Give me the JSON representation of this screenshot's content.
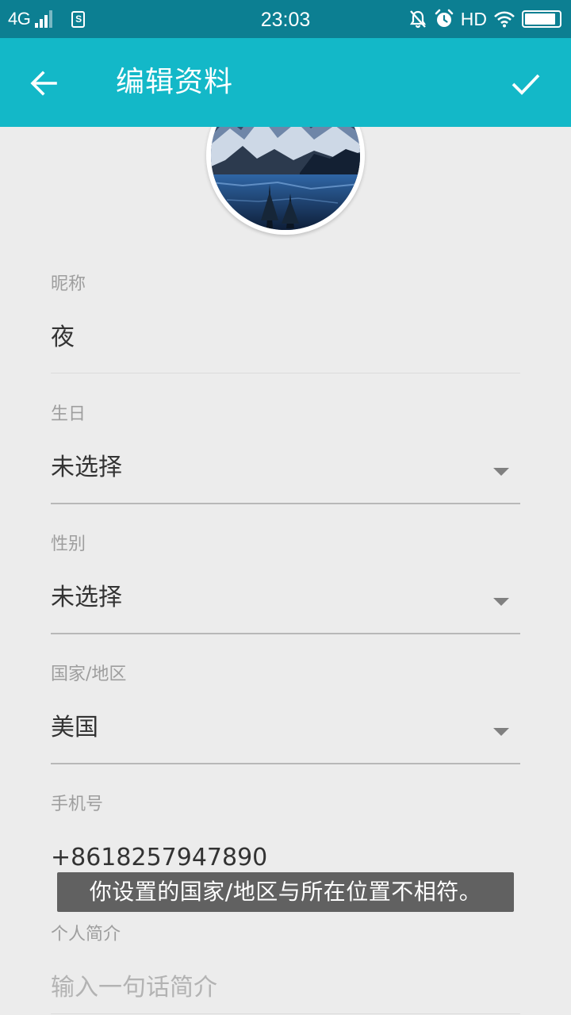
{
  "status_bar": {
    "network": "4G",
    "time": "23:03",
    "hd": "HD",
    "sd_icon_label": "S",
    "battery_level": 0.9,
    "icons": [
      "signal-icon",
      "sd-card-icon",
      "bell-off-icon",
      "alarm-icon",
      "wifi-icon",
      "battery-icon"
    ]
  },
  "app_bar": {
    "title": "编辑资料",
    "back_icon": "arrow-left-icon",
    "confirm_icon": "check-icon",
    "color": "#13b8c8"
  },
  "avatar": {
    "icon": "avatar-lake-mountain-image"
  },
  "form": {
    "nickname": {
      "label": "昵称",
      "value": "夜"
    },
    "birthday": {
      "label": "生日",
      "value": "未选择"
    },
    "gender": {
      "label": "性别",
      "value": "未选择"
    },
    "region": {
      "label": "国家/地区",
      "value": "美国"
    },
    "phone": {
      "label": "手机号",
      "value": "+8618257947890"
    },
    "bio": {
      "label": "个人简介",
      "placeholder": "输入一句话简介"
    }
  },
  "toast": {
    "message": "你设置的国家/地区与所在位置不相符。"
  }
}
